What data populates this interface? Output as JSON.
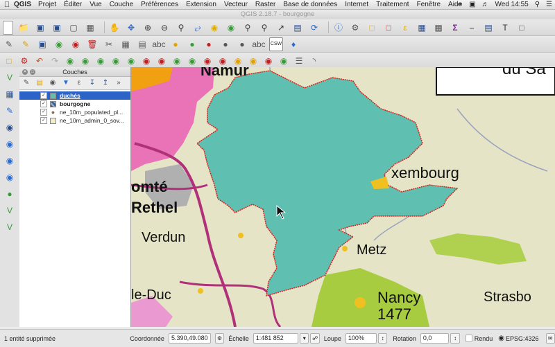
{
  "menubar": {
    "app_name": "QGIS",
    "items": [
      "Projet",
      "Éditer",
      "Vue",
      "Couche",
      "Préférences",
      "Extension",
      "Vecteur",
      "Raster",
      "Base de données",
      "Internet",
      "Traitement",
      "Fenêtre",
      "Aide"
    ],
    "clock": "Wed 14:55"
  },
  "window": {
    "title": "QGIS 2.18.7 - bourgogne"
  },
  "layers_panel": {
    "title": "Couches",
    "layers": [
      {
        "name": "duchés",
        "type": "polygon",
        "color": "#5fbfb0",
        "checked": true,
        "selected": true
      },
      {
        "name": "bourgogne",
        "type": "raster",
        "color": "#2e5e9a",
        "checked": true,
        "selected": false
      },
      {
        "name": "ne_10m_populated_pl...",
        "type": "point",
        "color": "#8a6a4a",
        "checked": true,
        "selected": false
      },
      {
        "name": "ne_10m_admin_0_sov...",
        "type": "polygon",
        "color": "#f1efc1",
        "checked": true,
        "selected": false
      }
    ]
  },
  "map": {
    "labels": {
      "top_label": "Namur",
      "top_right": "du Sa",
      "comte": "omté",
      "rethel": "Rethel",
      "verdun": "Verdun",
      "luxembourg": "xembourg",
      "metz": "Metz",
      "bar_le_duc": "le-Duc",
      "nancy": "Nancy",
      "nancy_year": "1477",
      "strasbourg": "Strasbo"
    }
  },
  "statusbar": {
    "message": "1 entité supprimée",
    "coord_label": "Coordonnée",
    "coord_value": "5.390,49.080",
    "scale_label": "Échelle",
    "scale_value": "1:481 852",
    "magnifier_label": "Loupe",
    "magnifier_value": "100%",
    "rotation_label": "Rotation",
    "rotation_value": "0,0",
    "render_label": "Rendu",
    "crs": "EPSG:4326"
  },
  "colors": {
    "selection": "#2b64c6",
    "duches_fill": "#5fbfb0",
    "duches_border": "#d8201c"
  }
}
